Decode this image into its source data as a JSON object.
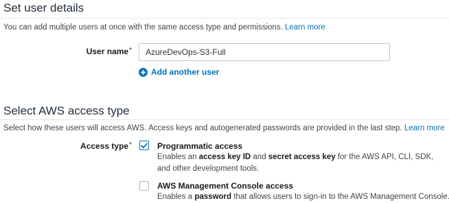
{
  "user_details": {
    "title": "Set user details",
    "description": "You can add multiple users at once with the same access type and permissions.",
    "learn_more": "Learn more",
    "user_name_label": "User name",
    "required_mark": "*",
    "user_name_value": "AzureDevOps-S3-Full",
    "add_another_user": "Add another user"
  },
  "access_type": {
    "title": "Select AWS access type",
    "description": "Select how these users will access AWS. Access keys and autogenerated passwords are provided in the last step.",
    "learn_more": "Learn more",
    "label": "Access type",
    "required_mark": "*",
    "options": [
      {
        "title": "Programmatic access",
        "checked": true,
        "desc_1": "Enables an ",
        "desc_2": "access key ID",
        "desc_3": " and ",
        "desc_4": "secret access key",
        "desc_5": " for the AWS API, CLI, SDK, and other development tools."
      },
      {
        "title": "AWS Management Console access",
        "checked": false,
        "desc_1": "Enables a ",
        "desc_2": "password",
        "desc_3": " that allows users to sign-in to the AWS Management Console."
      }
    ]
  },
  "icons": {
    "plus": "plus-circle-icon",
    "check": "checkmark-icon"
  },
  "colors": {
    "link": "#0073bb",
    "checkbox_checked": "#0073bb",
    "section_title": "#232f3e"
  }
}
